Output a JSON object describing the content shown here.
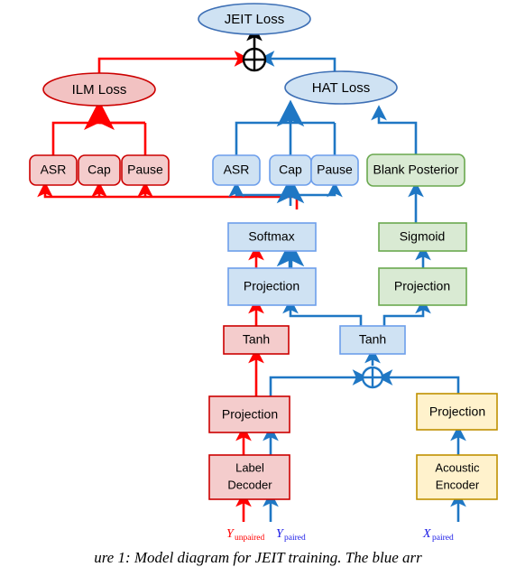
{
  "figure": {
    "caption": "ure 1:  Model diagram for JEIT training.  The blue arr",
    "caption_full_visible": "ure 1: Model diagram for JEIT training. The blue arr"
  },
  "colors": {
    "red_fill": "#f4cccc",
    "red_stroke": "#cc0000",
    "red_arrow": "#ff0000",
    "blue_fill": "#cfe2f3",
    "blue_stroke": "#6d9eeb",
    "blue_arrow": "#1f77c4",
    "green_fill": "#d9ead3",
    "green_stroke": "#6aa84f",
    "yellow_fill": "#fff2cc",
    "yellow_stroke": "#bf9000",
    "ellipse_blue_fill": "#cfe2f3",
    "ellipse_blue_stroke": "#3d6fb5",
    "ellipse_red_fill": "#f2c2c2",
    "ellipse_red_stroke": "#cc0000",
    "black": "#000000"
  },
  "nodes": {
    "jeit_loss": {
      "label": "JEIT Loss",
      "shape": "ellipse",
      "color": "blue"
    },
    "ilm_loss": {
      "label": "ILM Loss",
      "shape": "ellipse",
      "color": "red"
    },
    "hat_loss": {
      "label": "HAT Loss",
      "shape": "ellipse",
      "color": "blue"
    },
    "sum_top": {
      "label": "⊕",
      "shape": "circle-plus",
      "color": "black"
    },
    "sum_mid": {
      "label": "⊕",
      "shape": "circle-plus",
      "color": "blue"
    },
    "ilm_asr": {
      "label": "ASR",
      "color": "red"
    },
    "ilm_cap": {
      "label": "Cap",
      "color": "red"
    },
    "ilm_pause": {
      "label": "Pause",
      "color": "red"
    },
    "hat_asr": {
      "label": "ASR",
      "color": "blue"
    },
    "hat_cap": {
      "label": "Cap",
      "color": "blue"
    },
    "hat_pause": {
      "label": "Pause",
      "color": "blue"
    },
    "blank_posterior": {
      "label": "Blank Posterior",
      "color": "green"
    },
    "softmax": {
      "label": "Softmax",
      "color": "blue"
    },
    "sigmoid": {
      "label": "Sigmoid",
      "color": "green"
    },
    "projection_blue": {
      "label": "Projection",
      "color": "blue"
    },
    "projection_green": {
      "label": "Projection",
      "color": "green"
    },
    "tanh_red": {
      "label": "Tanh",
      "color": "red"
    },
    "tanh_blue": {
      "label": "Tanh",
      "color": "blue"
    },
    "projection_red": {
      "label": "Projection",
      "color": "red"
    },
    "projection_yellow": {
      "label": "Projection",
      "color": "yellow"
    },
    "label_decoder": {
      "label_line1": "Label",
      "label_line2": "Decoder",
      "color": "red"
    },
    "acoustic_encoder": {
      "label_line1": "Acoustic",
      "label_line2": "Encoder",
      "color": "yellow"
    }
  },
  "inputs": {
    "y_unpaired": {
      "base": "Y",
      "sub": "unpaired",
      "color": "#ff0000"
    },
    "y_paired": {
      "base": "Y",
      "sub": "paired",
      "color": "#1a1ae6"
    },
    "x_paired": {
      "base": "X",
      "sub": "paired",
      "color": "#1a1ae6"
    }
  }
}
